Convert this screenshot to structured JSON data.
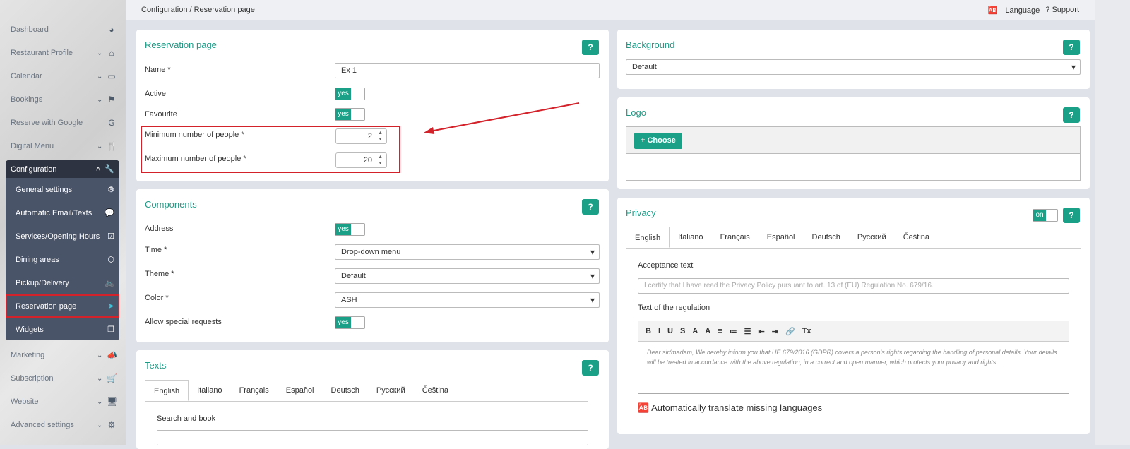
{
  "sidebar": {
    "items": [
      {
        "label": "Dashboard",
        "icon": "dashboard-icon",
        "glyph": "◕",
        "chev": false
      },
      {
        "label": "Restaurant Profile",
        "icon": "home-icon",
        "glyph": "⌂",
        "chev": true
      },
      {
        "label": "Calendar",
        "icon": "calendar-icon",
        "glyph": "▭",
        "chev": true
      },
      {
        "label": "Bookings",
        "icon": "flag-icon",
        "glyph": "⚑",
        "chev": true
      },
      {
        "label": "Reserve with Google",
        "icon": "google-icon",
        "glyph": "G",
        "chev": false
      },
      {
        "label": "Digital Menu",
        "icon": "utensils-icon",
        "glyph": "🍴",
        "chev": true
      }
    ],
    "config": {
      "label": "Configuration",
      "glyph": "🔧",
      "subs": [
        {
          "label": "General settings",
          "glyph": "⚙"
        },
        {
          "label": "Automatic Email/Texts",
          "glyph": "💬"
        },
        {
          "label": "Services/Opening Hours",
          "glyph": "☑"
        },
        {
          "label": "Dining areas",
          "glyph": "⬡"
        },
        {
          "label": "Pickup/Delivery",
          "glyph": "🚲"
        },
        {
          "label": "Reservation page",
          "glyph": "➤"
        },
        {
          "label": "Widgets",
          "glyph": "❐"
        }
      ]
    },
    "bottom": [
      {
        "label": "Marketing",
        "glyph": "📣"
      },
      {
        "label": "Subscription",
        "glyph": "🛒"
      },
      {
        "label": "Website",
        "glyph": "🖥"
      },
      {
        "label": "Advanced settings",
        "glyph": "⚙"
      }
    ]
  },
  "topbar": {
    "breadcrumb": "Configuration / Reservation page",
    "language": "Language",
    "support": "? Support"
  },
  "help": "?",
  "reservation": {
    "title": "Reservation page",
    "name_label": "Name *",
    "name_value": "Ex 1",
    "active_label": "Active",
    "favourite_label": "Favourite",
    "yes": "yes",
    "min_label": "Minimum number of people *",
    "min_value": "2",
    "max_label": "Maximum number of people *",
    "max_value": "20"
  },
  "components": {
    "title": "Components",
    "address": "Address",
    "time": "Time *",
    "time_value": "Drop-down menu",
    "theme": "Theme *",
    "theme_value": "Default",
    "color": "Color *",
    "color_value": "ASH",
    "special": "Allow special requests"
  },
  "texts": {
    "title": "Texts",
    "search_label": "Search and book"
  },
  "languages": [
    "English",
    "Italiano",
    "Français",
    "Español",
    "Deutsch",
    "Русский",
    "Čeština"
  ],
  "background": {
    "title": "Background",
    "value": "Default"
  },
  "logo": {
    "title": "Logo",
    "choose": "+ Choose"
  },
  "privacy": {
    "title": "Privacy",
    "toggle": "on",
    "acceptance_label": "Acceptance text",
    "acceptance_placeholder": "I certify that I have read the Privacy Policy pursuant to art. 13 of (EU) Regulation No. 679/16.",
    "regulation_label": "Text of the regulation",
    "toolbar": [
      "B",
      "I",
      "U",
      "S",
      "A",
      "A",
      "≡",
      "≔",
      "☰",
      "⇤",
      "⇥",
      "🔗",
      "Tx"
    ],
    "regulation_text": "Dear sir/madam, We hereby inform you that UE 679/2016 (GDPR) covers a person's rights regarding the handling of personal details. Your details will be treated in accordance with the above regulation, in a correct and open manner, which protects your privacy and rights....",
    "auto_translate": "Automatically translate missing languages"
  }
}
